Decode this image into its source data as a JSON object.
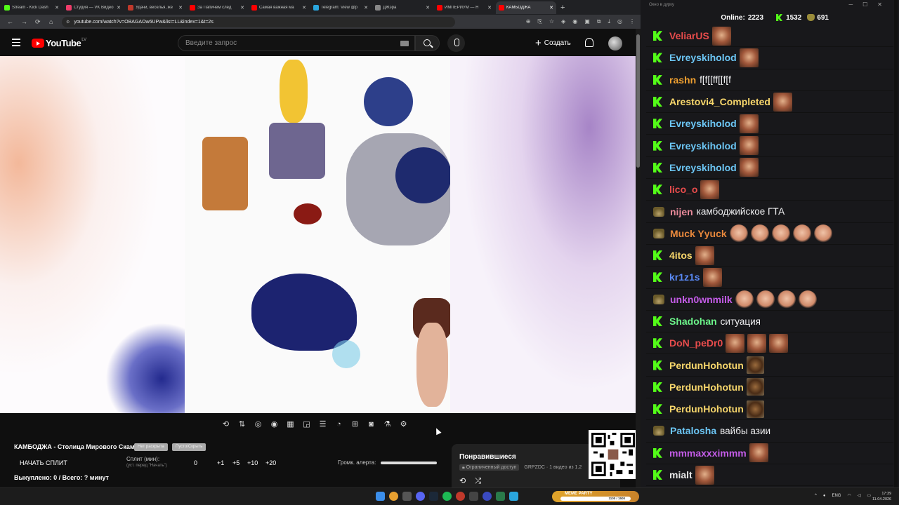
{
  "browser": {
    "tabs": [
      {
        "label": "Stream - Kick Dash",
        "color": "#53fc18"
      },
      {
        "label": "Студия — VK Видео",
        "color": "#ee3c6a"
      },
      {
        "label": "Удачи, веселья, же",
        "color": "#c0392b"
      },
      {
        "label": "За Папичем след",
        "color": "#ff0000"
      },
      {
        "label": "Самая важная ма",
        "color": "#ff0000"
      },
      {
        "label": "Telegram: View @p",
        "color": "#2aa6de"
      },
      {
        "label": "ДЖэра",
        "color": "#888888"
      },
      {
        "label": "ИМПЕРИУМ — Н",
        "color": "#ff0000"
      },
      {
        "label": "КАМБОДЖА",
        "color": "#ff0000",
        "active": true
      }
    ],
    "url": "youtube.com/watch?v=OBAGAOw6UPw&list=LL&index=1&t=2s"
  },
  "youtube": {
    "brand": "YouTube",
    "region": "LV",
    "search_placeholder": "Введите запрос",
    "create_label": "Создать"
  },
  "overlay": {
    "title": "КАМБОДЖА - Столица Мирового Скама",
    "chip1": "Нет раскрыта",
    "chip2": "Пусто/Скрыть",
    "start_split": "НАЧАТЬ СПЛИТ",
    "split_label": "Сплит (мин):",
    "split_hint": "(уст. перед \"Начать\")",
    "split_values": [
      "0",
      "+1",
      "+5",
      "+10",
      "+20"
    ],
    "volume_label": "Громк. алерта:",
    "bought": "Выкуплено: 0 / Всего: ? минут"
  },
  "liked": {
    "title": "Понравившиеся",
    "access": "Ограниченный доступ",
    "meta": "GRPZDC · 1 видео из 1.2"
  },
  "chat": {
    "window_title": "Окно в дурку",
    "online_label": "Online:",
    "online": "2223",
    "kick_count": "1532",
    "other_count": "691",
    "messages": [
      {
        "user": "VeliarUS",
        "color": "#e84c4c",
        "badge": "kick",
        "text": "",
        "emotes": 1,
        "emote_type": "emote"
      },
      {
        "user": "Evreyskiholod",
        "color": "#6cc6f5",
        "badge": "kick",
        "text": "",
        "emotes": 1,
        "emote_type": "emote"
      },
      {
        "user": "rashn",
        "color": "#f0a030",
        "badge": "kick",
        "text": "f[f[[ff[[f[f",
        "emotes": 0,
        "emote_type": ""
      },
      {
        "user": "Arestovi4_Completed",
        "color": "#f7d66b",
        "badge": "kick",
        "text": "",
        "emotes": 1,
        "emote_type": "emote"
      },
      {
        "user": "Evreyskiholod",
        "color": "#6cc6f5",
        "badge": "kick",
        "text": "",
        "emotes": 1,
        "emote_type": "emote"
      },
      {
        "user": "Evreyskiholod",
        "color": "#6cc6f5",
        "badge": "kick",
        "text": "",
        "emotes": 1,
        "emote_type": "emote"
      },
      {
        "user": "Evreyskiholod",
        "color": "#6cc6f5",
        "badge": "kick",
        "text": "",
        "emotes": 1,
        "emote_type": "emote"
      },
      {
        "user": "lico_o",
        "color": "#e84c4c",
        "badge": "kick",
        "text": "",
        "emotes": 1,
        "emote_type": "emote"
      },
      {
        "user": "nijen",
        "color": "#e88a9a",
        "badge": "frog",
        "text": "камбоджийское ГТА",
        "emotes": 0,
        "emote_type": ""
      },
      {
        "user": "Muck Yyuck",
        "color": "#e8883c",
        "badge": "frog",
        "text": "",
        "emotes": 5,
        "emote_type": "bald"
      },
      {
        "user": "4itos",
        "color": "#f7d66b",
        "badge": "kick",
        "text": "",
        "emotes": 1,
        "emote_type": "emote"
      },
      {
        "user": "kr1z1s",
        "color": "#5a8af7",
        "badge": "kick",
        "text": "",
        "emotes": 1,
        "emote_type": "emote"
      },
      {
        "user": "unkn0wnmilk",
        "color": "#c45ce8",
        "badge": "frog",
        "text": "",
        "emotes": 4,
        "emote_type": "bald"
      },
      {
        "user": "Shadohan",
        "color": "#6cf58a",
        "badge": "kick",
        "text": "ситуация",
        "emotes": 0,
        "emote_type": ""
      },
      {
        "user": "DoN_peDr0",
        "color": "#e84c4c",
        "badge": "kick",
        "text": "",
        "emotes": 3,
        "emote_type": "emote"
      },
      {
        "user": "PerdunHohotun",
        "color": "#f7d66b",
        "badge": "kick",
        "text": "",
        "emotes": 1,
        "emote_type": "dark"
      },
      {
        "user": "PerdunHohotun",
        "color": "#f7d66b",
        "badge": "kick",
        "text": "",
        "emotes": 1,
        "emote_type": "dark"
      },
      {
        "user": "PerdunHohotun",
        "color": "#f7d66b",
        "badge": "kick",
        "text": "",
        "emotes": 1,
        "emote_type": "dark"
      },
      {
        "user": "Patalosha",
        "color": "#6cc6f5",
        "badge": "frog",
        "text": "вайбы азии",
        "emotes": 0,
        "emote_type": ""
      },
      {
        "user": "mmmaxxximmm",
        "color": "#c45ce8",
        "badge": "kick",
        "text": "",
        "emotes": 1,
        "emote_type": "emote"
      },
      {
        "user": "mialt",
        "color": "#e8e8e8",
        "badge": "kick",
        "text": "",
        "emotes": 1,
        "emote_type": "emote"
      }
    ]
  },
  "taskbar": {
    "memes_label": "MEME PARTY",
    "memes_counter": "1100 / 1500",
    "lang": "ENG",
    "time": "17:39",
    "date": "11.04.2026"
  }
}
